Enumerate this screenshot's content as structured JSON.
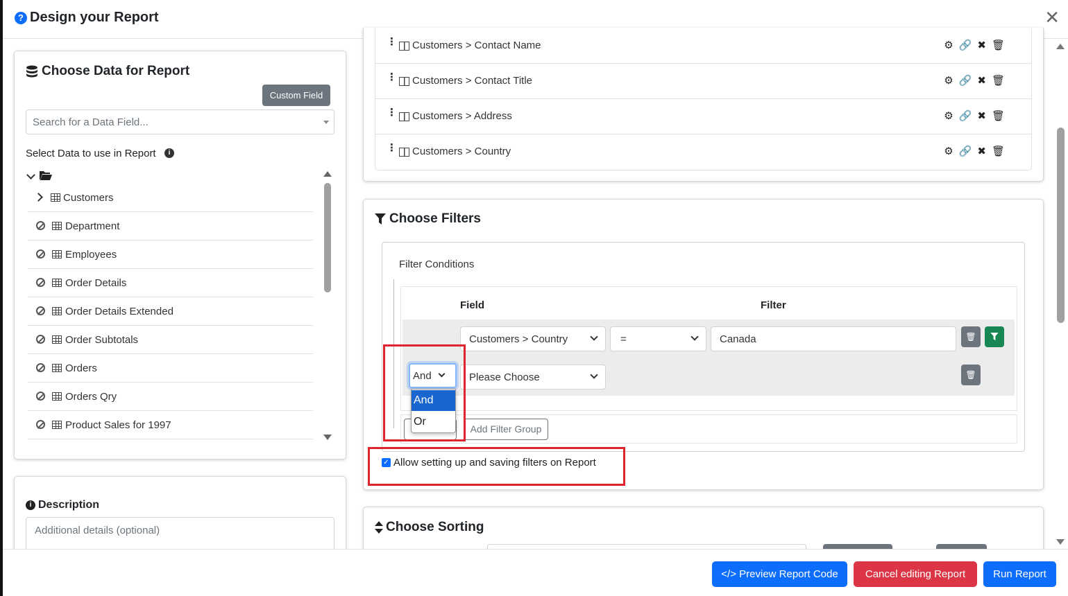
{
  "dialog": {
    "title": "Design your Report"
  },
  "data_panel": {
    "title": "Choose Data for Report",
    "custom_field_label": "Custom Field",
    "search_placeholder": "Search for a Data Field...",
    "select_label": "Select Data to use in Report",
    "tables": [
      "Customers",
      "Department",
      "Employees",
      "Order Details",
      "Order Details Extended",
      "Order Subtotals",
      "Orders",
      "Orders Qry",
      "Product Sales for 1997"
    ]
  },
  "description": {
    "title": "Description",
    "placeholder": "Additional details (optional)"
  },
  "columns": [
    {
      "table": "Customers",
      "field": "Contact Name"
    },
    {
      "table": "Customers",
      "field": "Contact Title"
    },
    {
      "table": "Customers",
      "field": "Address"
    },
    {
      "table": "Customers",
      "field": "Country"
    }
  ],
  "filters": {
    "title": "Choose Filters",
    "conditions_label": "Filter Conditions",
    "col_field": "Field",
    "col_filter": "Filter",
    "row1": {
      "field": "Customers > Country",
      "operator": "=",
      "value": "Canada"
    },
    "row2": {
      "connector": "And",
      "field": "Please Choose"
    },
    "dropdown_options": [
      "And",
      "Or"
    ],
    "add_group_label": "Add Filter Group",
    "allow_label": "Allow setting up and saving filters on Report",
    "allow_checked": true
  },
  "sorting": {
    "title": "Choose Sorting"
  },
  "footer": {
    "preview_label": "Preview Report Code",
    "cancel_label": "Cancel editing Report",
    "run_label": "Run Report"
  },
  "colors": {
    "primary": "#0d6efd",
    "danger": "#dc3545",
    "success": "#198754",
    "secondary": "#6c757d",
    "highlight": "#e0242e"
  }
}
